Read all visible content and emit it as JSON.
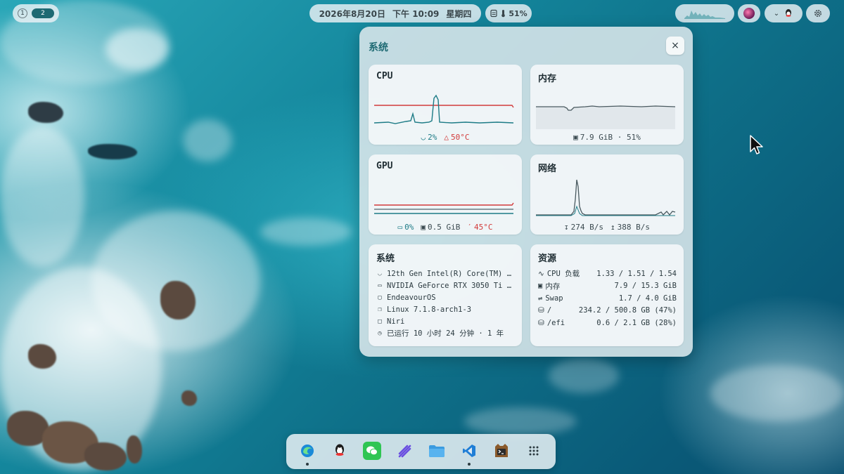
{
  "topbar": {
    "workspaces": [
      {
        "label": "1",
        "active": false
      },
      {
        "label": "2",
        "active": true
      }
    ],
    "date": "2026年8月20日",
    "time": "下午 10:09",
    "weekday": "星期四",
    "battery": "51%"
  },
  "panel": {
    "title": "系统",
    "close_label": "×",
    "cpu": {
      "title": "CPU",
      "usage": "2%",
      "temp": "50°C"
    },
    "memory": {
      "title": "内存",
      "summary": "7.9 GiB · 51%"
    },
    "gpu": {
      "title": "GPU",
      "usage": "0%",
      "vram": "0.5 GiB",
      "temp": "45°C"
    },
    "network": {
      "title": "网络",
      "down": "274 B/s",
      "up": "388 B/s"
    },
    "system": {
      "title": "系统",
      "cpu_model": "12th Gen Intel(R) Core(TM) i…",
      "gpu_model": "NVIDIA GeForce RTX 3050 Ti M…",
      "distro": "EndeavourOS",
      "kernel": "Linux 7.1.8-arch1-3",
      "wm": "Niri",
      "uptime": "已运行 10 小时 24 分钟 · 1 年"
    },
    "resources": {
      "title": "资源",
      "rows": [
        {
          "label": "CPU 负载",
          "value": "1.33 / 1.51 / 1.54",
          "icon": "activity-icon"
        },
        {
          "label": "内存",
          "value": "7.9 / 15.3 GiB",
          "icon": "chip-icon"
        },
        {
          "label": "Swap",
          "value": "1.7 / 4.0 GiB",
          "icon": "swap-icon"
        },
        {
          "label": "/",
          "value": "234.2 / 500.8 GB (47%)",
          "icon": "disk-icon"
        },
        {
          "label": "/efi",
          "value": "0.6 / 2.1 GB (28%)",
          "icon": "disk-icon"
        }
      ]
    }
  },
  "dock": {
    "apps": [
      "edge-icon",
      "qq-icon",
      "wechat-icon",
      "linear-icon",
      "files-icon",
      "vscode-icon",
      "terminal-icon",
      "app-grid-icon"
    ]
  },
  "colors": {
    "accent": "#1e6a73",
    "cpu_line": "#1d7b86",
    "limit_line": "#d23b3b"
  }
}
